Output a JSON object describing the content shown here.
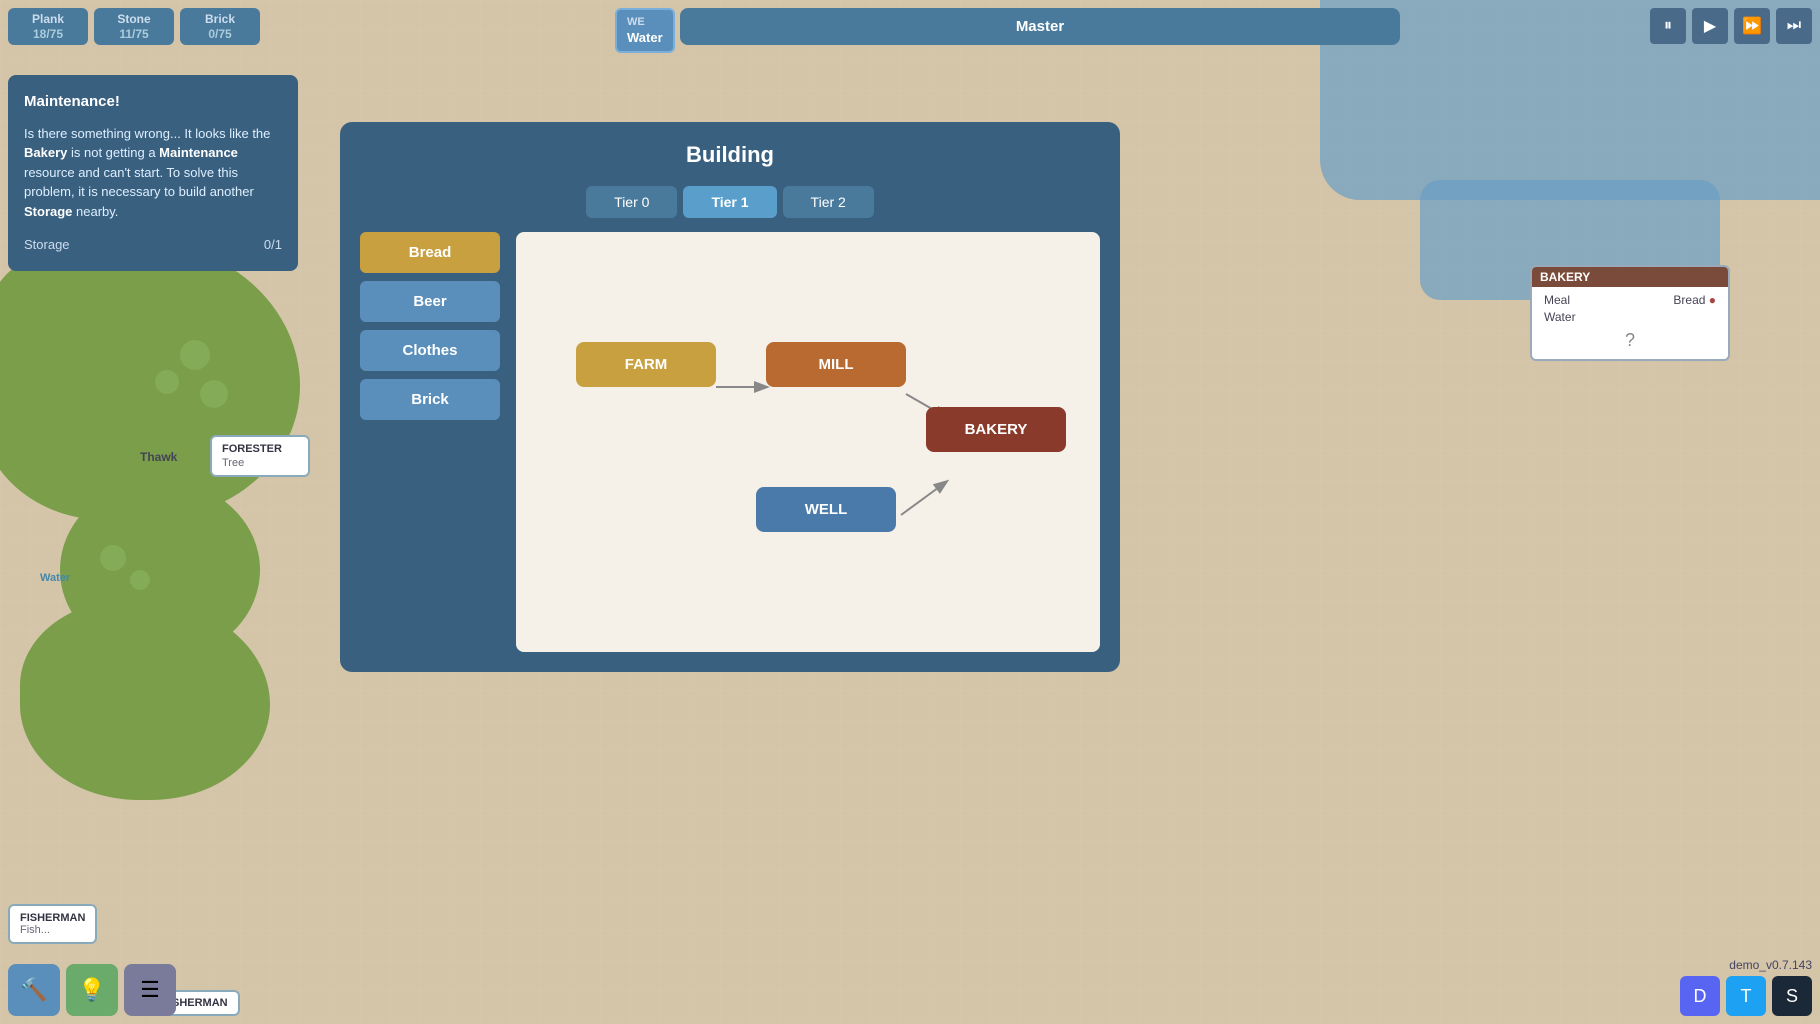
{
  "resources": {
    "plank": {
      "label": "Plank",
      "value": "18/75"
    },
    "stone": {
      "label": "Stone",
      "value": "11/75"
    },
    "brick": {
      "label": "Brick",
      "value": "0/75"
    }
  },
  "maintenance": {
    "title": "Maintenance!",
    "body_prefix": "Is there something wrong... It looks like the ",
    "bakery": "Bakery",
    "body_mid": " is not getting a ",
    "maintenance_word": "Maintenance",
    "body_suffix": " resource and can't start. To solve this problem, it is necessary to build another ",
    "storage_word": "Storage",
    "body_end": " nearby.",
    "storage_label": "Storage",
    "storage_value": "0/1"
  },
  "we_water": {
    "we": "WE",
    "water": "Water"
  },
  "master": {
    "title": "Master"
  },
  "bakery_node": {
    "title": "BAKERY",
    "meal_label": "Meal",
    "bread_label": "Bread",
    "water_label": "Water",
    "arrow": "►",
    "question": "?"
  },
  "map_nodes": {
    "forester": {
      "title": "FORESTER",
      "resource": "Tree"
    },
    "fisherman": {
      "title": "FISHERMAN",
      "resource": "Fish"
    },
    "sherman": "SHERMAN",
    "thawk": "Thawk"
  },
  "water_label": "Water",
  "building_dialog": {
    "title": "Building",
    "tiers": [
      {
        "label": "Tier 0"
      },
      {
        "label": "Tier 1"
      },
      {
        "label": "Tier 2"
      }
    ],
    "active_tier": 1,
    "categories": [
      {
        "label": "Bread",
        "active": true
      },
      {
        "label": "Beer",
        "active": false
      },
      {
        "label": "Clothes",
        "active": false
      },
      {
        "label": "Brick",
        "active": false
      }
    ],
    "diagram": {
      "farm": "FARM",
      "mill": "MILL",
      "bakery": "BAKERY",
      "well": "WELL"
    }
  },
  "toolbar": {
    "hammer_icon": "🔨",
    "light_icon": "💡",
    "menu_icon": "☰"
  },
  "controls": {
    "pause": "⏸",
    "play": "▶",
    "fast": "⏩",
    "faster": "⏭"
  },
  "version": "demo_v0.7.143",
  "social": {
    "discord": "D",
    "twitter": "T",
    "steam": "S"
  }
}
